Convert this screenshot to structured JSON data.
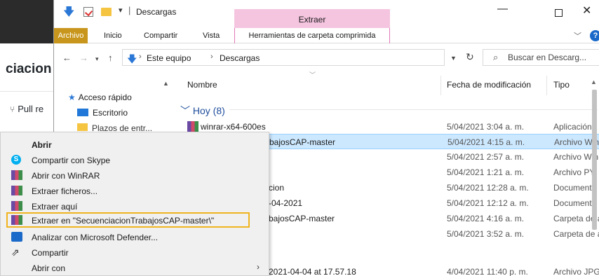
{
  "browser_bg": {
    "title": "ciacion",
    "pr_label": "Pull re"
  },
  "titlebar": {
    "title": "Descargas",
    "extract_tab": "Extraer",
    "minimize": "—",
    "close": "✕"
  },
  "ribbon": {
    "tabs": [
      "Archivo",
      "Inicio",
      "Compartir",
      "Vista",
      "Herramientas de carpeta comprimida"
    ],
    "help": "?"
  },
  "address": {
    "parts": [
      "Este equipo",
      "Descargas"
    ],
    "search_placeholder": "Buscar en Descarg..."
  },
  "navpane": {
    "items": [
      {
        "label": "Acceso rápido",
        "icon": "star-icon"
      },
      {
        "label": "Escritorio",
        "icon": "desktop-icon"
      },
      {
        "label": "Plazos de entr...",
        "icon": "folder-icon"
      }
    ]
  },
  "filelist": {
    "columns": [
      "Nombre",
      "Fecha de modificación",
      "Tipo"
    ],
    "group": "Hoy (8)",
    "rows": [
      {
        "name": "winrar-x64-600es",
        "date": "5/04/2021 3:04 a. m.",
        "type": "Aplicación"
      },
      {
        "name": "bajosCAP-master",
        "date": "5/04/2021 4:15 a. m.",
        "type": "Archivo WinRAR"
      },
      {
        "name": "",
        "date": "5/04/2021 2:57 a. m.",
        "type": "Archivo WinRAR"
      },
      {
        "name": "",
        "date": "5/04/2021 1:21 a. m.",
        "type": "Archivo PY"
      },
      {
        "name": "cion",
        "date": "5/04/2021 12:28 a. m.",
        "type": "Documento"
      },
      {
        "name": "-04-2021",
        "date": "5/04/2021 12:12 a. m.",
        "type": "Documento"
      },
      {
        "name": "bajosCAP-master",
        "date": "5/04/2021 4:16 a. m.",
        "type": "Carpeta de archivos"
      },
      {
        "name": "",
        "date": "5/04/2021 3:52 a. m.",
        "type": "Carpeta de archivos"
      },
      {
        "name": "2021-04-04 at 17.57.18",
        "date": "4/04/2021 11:40 p. m.",
        "type": "Archivo JPG"
      }
    ]
  },
  "context_menu": {
    "items": [
      {
        "label": "Abrir",
        "icon": ""
      },
      {
        "label": "Compartir con Skype",
        "icon": "skype-icon"
      },
      {
        "label": "Abrir con WinRAR",
        "icon": "winrar-icon"
      },
      {
        "label": "Extraer ficheros...",
        "icon": "winrar-icon"
      },
      {
        "label": "Extraer aquí",
        "icon": "winrar-icon"
      },
      {
        "label": "Extraer en \"SecuenciacionTrabajosCAP-master\\\"",
        "icon": "winrar-icon"
      },
      {
        "label": "Analizar con Microsoft Defender...",
        "icon": "defender-icon"
      },
      {
        "label": "Compartir",
        "icon": "share-icon"
      },
      {
        "label": "Abrir con",
        "icon": ""
      }
    ]
  },
  "colors": {
    "archivo_tab": "#c8961c",
    "extract_tab": "#f5c5e0",
    "selection": "#cce8ff",
    "highlight": "#f0b41e"
  }
}
